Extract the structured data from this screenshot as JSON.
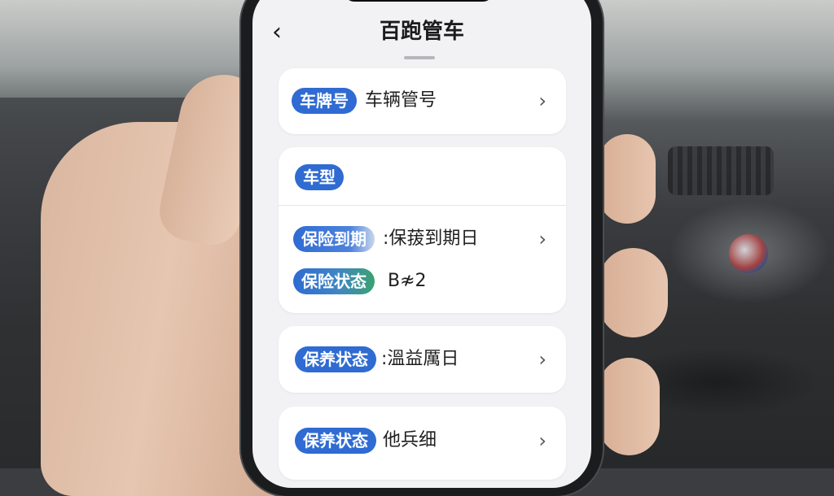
{
  "header": {
    "back_icon": "‹",
    "title": "百跑管车"
  },
  "rows": {
    "plate": {
      "tag": "车牌号",
      "value": "车辆管号"
    },
    "model": {
      "tag": "车型"
    },
    "insurance_due": {
      "tag": "保险到期",
      "value": ":保菝到期日"
    },
    "insurance_status": {
      "tag": "保险状态",
      "value": "B≉2"
    },
    "maintenance_status_1": {
      "tag": "保养状态",
      "value": ":溫益厲日"
    },
    "maintenance_status_2": {
      "tag": "保养状态",
      "value": "他兵细"
    }
  },
  "icons": {
    "chevron": "›"
  },
  "colors": {
    "tag_blue": "#2f6bd2",
    "tag_green": "#3aa270",
    "screen_bg": "#f2f2f4"
  }
}
